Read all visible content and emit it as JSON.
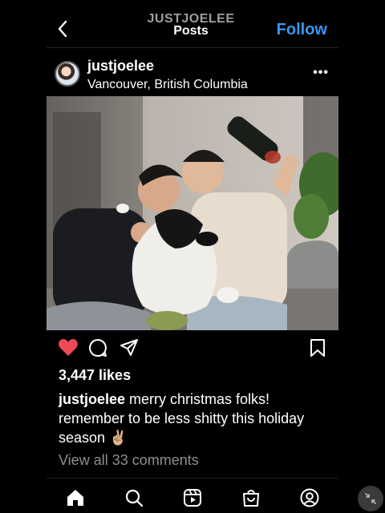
{
  "topbar": {
    "username_upper": "JUSTJOELEE",
    "section": "Posts",
    "follow": "Follow",
    "back_icon": "chevron-left-icon"
  },
  "post": {
    "username": "justjoelee",
    "location": "Vancouver, British Columbia",
    "more": "•••",
    "likes": "3,447 likes",
    "caption_user": "justjoelee",
    "caption_text": " merry christmas folks! remember to be less shitty this holiday season ✌🏼",
    "comments_link": "View all 33 comments",
    "liked": true
  },
  "colors": {
    "accent": "#3897f0",
    "heart": "#ed4956",
    "muted": "#8e8e8e"
  },
  "tabs": [
    "home-icon",
    "search-icon",
    "reels-icon",
    "shop-icon",
    "profile-icon"
  ]
}
